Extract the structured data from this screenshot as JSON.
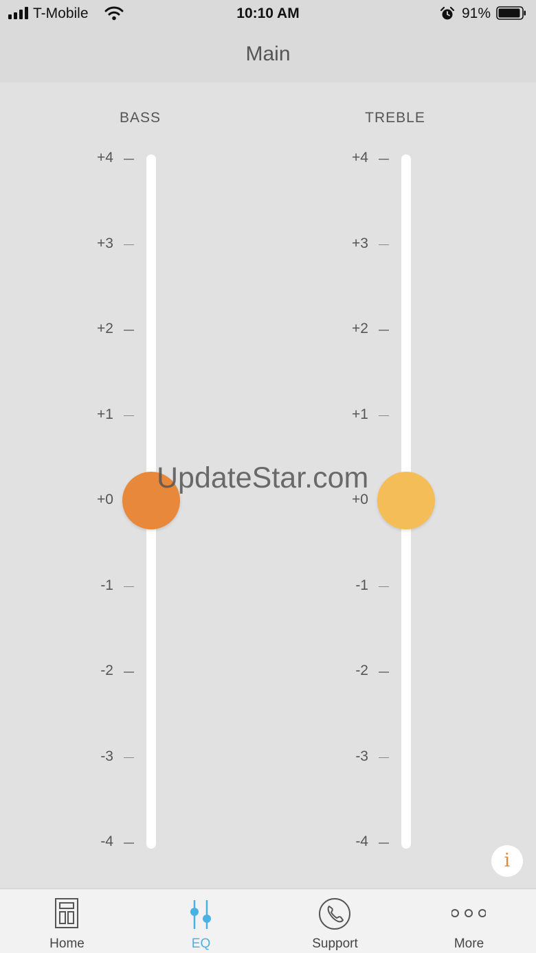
{
  "status": {
    "carrier": "T-Mobile",
    "time": "10:10 AM",
    "battery": "91%",
    "icons": [
      "signal-icon",
      "wifi-icon",
      "alarm-icon",
      "battery-icon"
    ]
  },
  "nav": {
    "title": "Main"
  },
  "eq": {
    "ticks": [
      "+4",
      "+3",
      "+2",
      "+1",
      "+0",
      "-1",
      "-2",
      "-3",
      "-4"
    ],
    "sliders": [
      {
        "label": "BASS",
        "value": 0,
        "color": "#e8883a"
      },
      {
        "label": "TREBLE",
        "value": 0,
        "color": "#f4bd57"
      }
    ]
  },
  "watermark": "UpdateStar.com",
  "info": {
    "glyph": "i",
    "icon": "info-icon"
  },
  "tabs": [
    {
      "label": "Home",
      "icon": "home-icon",
      "active": false
    },
    {
      "label": "EQ",
      "icon": "eq-sliders-icon",
      "active": true
    },
    {
      "label": "Support",
      "icon": "phone-icon",
      "active": false
    },
    {
      "label": "More",
      "icon": "more-dots-icon",
      "active": false
    }
  ],
  "colors": {
    "accent": "#4ab2e3",
    "background": "#e1e1e1",
    "bar": "#dadada"
  }
}
